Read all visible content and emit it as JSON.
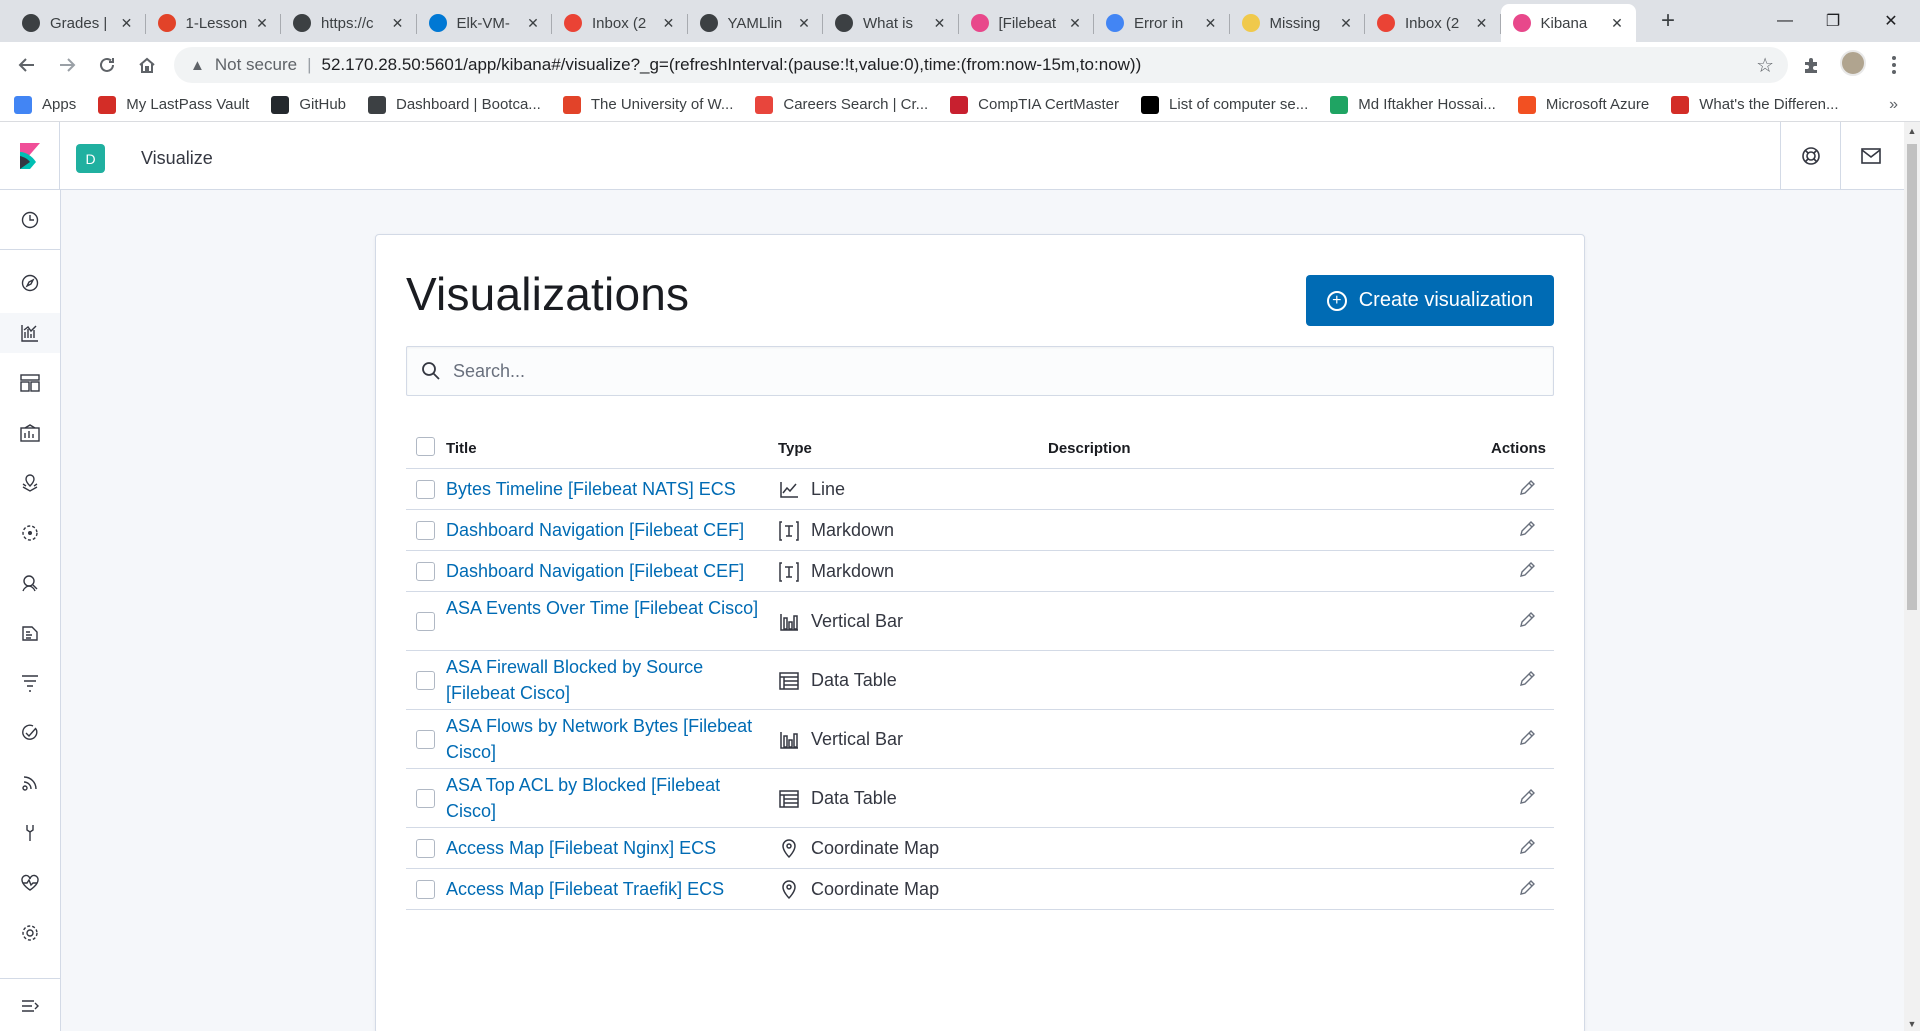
{
  "browser": {
    "tabs": [
      {
        "title": "Grades |",
        "icon": "globe-icon",
        "color": "#3c4043"
      },
      {
        "title": "1-Lesson",
        "icon": "gitlab-icon",
        "color": "#e24329"
      },
      {
        "title": "https://c",
        "icon": "globe-icon",
        "color": "#3c4043"
      },
      {
        "title": "Elk-VM-",
        "icon": "azure-icon",
        "color": "#0078d4"
      },
      {
        "title": "Inbox (2",
        "icon": "gmail-icon",
        "color": "#ea4335"
      },
      {
        "title": "YAMLlin",
        "icon": "globe-icon",
        "color": "#3c4043"
      },
      {
        "title": "What is",
        "icon": "globe-icon",
        "color": "#3c4043"
      },
      {
        "title": "[Filebeat",
        "icon": "kibana-icon",
        "color": "#e8488b"
      },
      {
        "title": "Error in",
        "icon": "google-icon",
        "color": "#4285f4"
      },
      {
        "title": "Missing",
        "icon": "elastic-icon",
        "color": "#f0c94b"
      },
      {
        "title": "Inbox (2",
        "icon": "gmail-icon",
        "color": "#ea4335"
      },
      {
        "title": "Kibana",
        "icon": "kibana-icon",
        "color": "#e8488b",
        "active": true
      }
    ],
    "new_tab": "+",
    "window_controls": {
      "minimize": "—",
      "maximize": "❐",
      "close": "✕"
    },
    "omnibox": {
      "security_label": "Not secure",
      "separator": "|",
      "url": "52.170.28.50:5601/app/kibana#/visualize?_g=(refreshInterval:(pause:!t,value:0),time:(from:now-15m,to:now))"
    },
    "bookmarks": [
      {
        "label": "Apps",
        "icon": "apps-grid-icon",
        "color": "#4285f4"
      },
      {
        "label": "My LastPass Vault",
        "icon": "lastpass-icon",
        "color": "#d32d27"
      },
      {
        "label": "GitHub",
        "icon": "github-icon",
        "color": "#24292e"
      },
      {
        "label": "Dashboard | Bootca...",
        "icon": "globe-icon",
        "color": "#3c4043"
      },
      {
        "label": "The University of W...",
        "icon": "gitlab-icon",
        "color": "#e24329"
      },
      {
        "label": "Careers Search | Cr...",
        "icon": "bird-icon",
        "color": "#e8453c"
      },
      {
        "label": "CompTIA CertMaster",
        "icon": "comptia-icon",
        "color": "#c8202f"
      },
      {
        "label": "List of computer se...",
        "icon": "wikipedia-icon",
        "color": "#000000"
      },
      {
        "label": "Md Iftakher Hossai...",
        "icon": "drive-icon",
        "color": "#1fa463"
      },
      {
        "label": "Microsoft Azure",
        "icon": "microsoft-icon",
        "color": "#f25022"
      },
      {
        "label": "What's the Differen...",
        "icon": "bookmark-app-icon",
        "color": "#d32d27"
      }
    ],
    "bookmarks_more": "»"
  },
  "kibana": {
    "space_initial": "D",
    "breadcrumb": "Visualize",
    "page_title": "Visualizations",
    "create_button": "Create visualization",
    "search_placeholder": "Search...",
    "columns": {
      "title": "Title",
      "type": "Type",
      "description": "Description",
      "actions": "Actions"
    },
    "rows": [
      {
        "title": "Bytes Timeline [Filebeat NATS] ECS",
        "type": "Line",
        "type_icon": "line-chart-icon"
      },
      {
        "title": "Dashboard Navigation [Filebeat CEF]",
        "type": "Markdown",
        "type_icon": "markdown-icon"
      },
      {
        "title": "Dashboard Navigation [Filebeat CEF]",
        "type": "Markdown",
        "type_icon": "markdown-icon"
      },
      {
        "title": "ASA Events Over Time [Filebeat Cisco]",
        "type": "Vertical Bar",
        "type_icon": "vertical-bar-icon"
      },
      {
        "title": "ASA Firewall Blocked by Source [Filebeat Cisco]",
        "type": "Data Table",
        "type_icon": "data-table-icon"
      },
      {
        "title": "ASA Flows by Network Bytes [Filebeat Cisco]",
        "type": "Vertical Bar",
        "type_icon": "vertical-bar-icon"
      },
      {
        "title": "ASA Top ACL by Blocked [Filebeat Cisco]",
        "type": "Data Table",
        "type_icon": "data-table-icon"
      },
      {
        "title": "Access Map [Filebeat Nginx] ECS",
        "type": "Coordinate Map",
        "type_icon": "map-pin-icon"
      },
      {
        "title": "Access Map [Filebeat Traefik] ECS",
        "type": "Coordinate Map",
        "type_icon": "map-pin-icon"
      }
    ],
    "colors": {
      "link": "#006bb4",
      "primary_button": "#006bb4",
      "space_badge": "#20b0a0"
    }
  }
}
